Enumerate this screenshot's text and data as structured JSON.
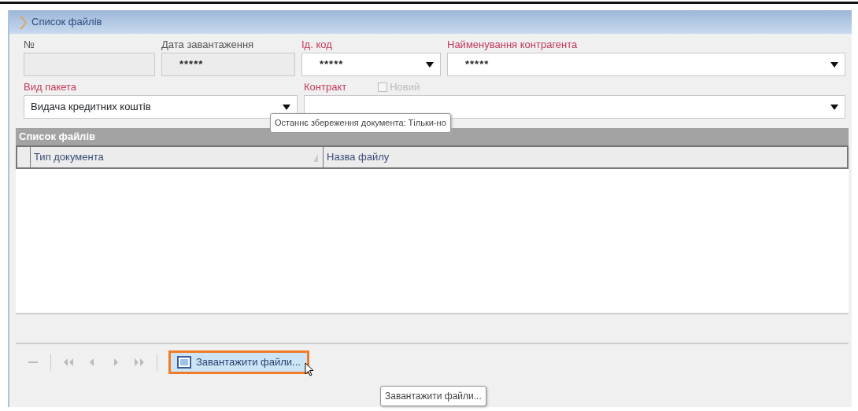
{
  "window": {
    "title": "Список файлів"
  },
  "fields_row_1": [
    {
      "label": "№",
      "required": false,
      "disabled": true,
      "kind": "text"
    },
    {
      "label": "Дата завантаження",
      "required": false,
      "disabled": true,
      "kind": "text",
      "value": "*****"
    },
    {
      "label": "Ід. код",
      "required": true,
      "disabled": false,
      "kind": "select",
      "value": "*****"
    },
    {
      "label": "Найменування контрагента",
      "required": true,
      "disabled": false,
      "kind": "select",
      "value": "*****"
    }
  ],
  "fields_row_2": [
    {
      "label": "Вид пакета",
      "required": true,
      "disabled": false,
      "kind": "select",
      "value": "Видача кредитних коштів"
    },
    {
      "label": "Контракт",
      "required": true,
      "disabled": false,
      "kind": "select",
      "checkbox": {
        "label": "Новий",
        "checked": false,
        "disabled": true
      }
    }
  ],
  "tooltip": "Останнє збереження документа: Тільки-но",
  "grid": {
    "title": "Список файлів",
    "columns": [
      {
        "label": "Тип документа",
        "sortable": true
      },
      {
        "label": "Назва файлу",
        "sortable": false
      }
    ]
  },
  "toolbar": {
    "upload_button": {
      "label": "Завантажити файли...",
      "hovered": true
    },
    "upload_tooltip": "Завантажити файли..."
  }
}
